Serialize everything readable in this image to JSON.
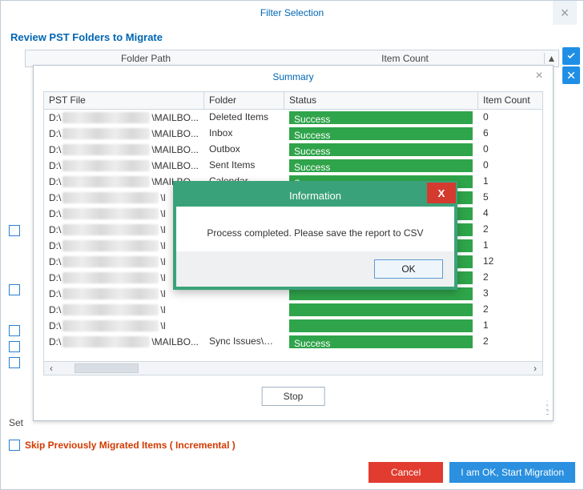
{
  "filter": {
    "title": "Filter Selection",
    "review_header": "Review PST Folders to Migrate",
    "cols": {
      "folder_path": "Folder Path",
      "item_count": "Item Count"
    },
    "set_label": "Set",
    "skip_label": "Skip Previously Migrated Items ( Incremental )",
    "cancel": "Cancel",
    "ok": "I am OK, Start Migration"
  },
  "summary": {
    "title": "Summary",
    "columns": {
      "pst": "PST File",
      "folder": "Folder",
      "status": "Status",
      "count": "Item Count"
    },
    "stop": "Stop",
    "rows": [
      {
        "prefix": "D:\\",
        "suffix": "\\MAILBO...",
        "folder": "Deleted Items",
        "status": "Success",
        "count": "0"
      },
      {
        "prefix": "D:\\",
        "suffix": "\\MAILBO...",
        "folder": "Inbox",
        "status": "Success",
        "count": "6"
      },
      {
        "prefix": "D:\\",
        "suffix": "\\MAILBO...",
        "folder": "Outbox",
        "status": "Success",
        "count": "0"
      },
      {
        "prefix": "D:\\",
        "suffix": "\\MAILBO...",
        "folder": "Sent Items",
        "status": "Success",
        "count": "0"
      },
      {
        "prefix": "D:\\",
        "suffix": "\\MAILBO...",
        "folder": "Calendar",
        "status": "Success",
        "count": "1"
      },
      {
        "prefix": "D:\\",
        "suffix": "\\I",
        "folder": "",
        "status": "",
        "count": "5"
      },
      {
        "prefix": "D:\\",
        "suffix": "\\I",
        "folder": "",
        "status": "",
        "count": "4"
      },
      {
        "prefix": "D:\\",
        "suffix": "\\I",
        "folder": "",
        "status": "",
        "count": "2"
      },
      {
        "prefix": "D:\\",
        "suffix": "\\I",
        "folder": "",
        "status": "",
        "count": "1"
      },
      {
        "prefix": "D:\\",
        "suffix": "\\I",
        "folder": "",
        "status": "",
        "count": "12"
      },
      {
        "prefix": "D:\\",
        "suffix": "\\I",
        "folder": "",
        "status": "",
        "count": "2"
      },
      {
        "prefix": "D:\\",
        "suffix": "\\I",
        "folder": "",
        "status": "",
        "count": "3"
      },
      {
        "prefix": "D:\\",
        "suffix": "\\I",
        "folder": "",
        "status": "",
        "count": "2"
      },
      {
        "prefix": "D:\\",
        "suffix": "\\I",
        "folder": "",
        "status": "",
        "count": "1"
      },
      {
        "prefix": "D:\\",
        "suffix": "\\MAILBO...",
        "folder": "Sync Issues\\Se...",
        "status": "Success",
        "count": "2"
      }
    ]
  },
  "info": {
    "title": "Information",
    "message": "Process completed. Please save the report to CSV",
    "ok": "OK",
    "close": "X"
  }
}
